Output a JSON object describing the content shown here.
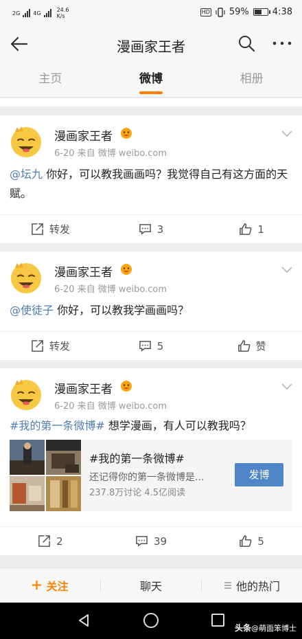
{
  "status": {
    "net_left": "2G",
    "net_right": "4G",
    "speed": "24.6",
    "speed_unit": "K/s",
    "hd": "HD",
    "battery": "59%",
    "battery_level": 0.59,
    "time": "4:38"
  },
  "nav": {
    "title": "漫画家王者"
  },
  "tabs": [
    {
      "label": "主页"
    },
    {
      "label": "微博"
    },
    {
      "label": "相册"
    }
  ],
  "posts": [
    {
      "author": "漫画家王者",
      "meta": "6-20  来自 微博 weibo.com",
      "mention": "@坛九",
      "text": " 你好，可以教我画画吗？我觉得自己有这方面的天赋。",
      "repost": "转发",
      "comments": "3",
      "likes": "1"
    },
    {
      "author": "漫画家王者",
      "meta": "6-20  来自 微博 weibo.com",
      "mention": "@使徒子",
      "text": " 你好，可以教我学画画吗？",
      "repost": "转发",
      "comments": "5",
      "likes": "赞"
    },
    {
      "author": "漫画家王者",
      "meta": "6-20  来自 微博 weibo.com",
      "mention": "#我的第一条微博#",
      "text": " 想学漫画，有人可以教我吗？",
      "topic": {
        "title": "#我的第一条微博#",
        "subtitle": "还记得你的第一条微博是...",
        "stats": "237.8万讨论   4.5亿阅读",
        "button": "发博"
      },
      "repost": "2",
      "comments": "39",
      "likes": "5"
    }
  ],
  "bottom": {
    "follow": "关注",
    "chat": "聊天",
    "hot": "他的热门"
  },
  "watermark": {
    "brand": "头条",
    "account": "@萌面笨博士"
  },
  "colors": {
    "accent": "#ff8200",
    "link": "#507daf",
    "button": "#4f86c7"
  }
}
